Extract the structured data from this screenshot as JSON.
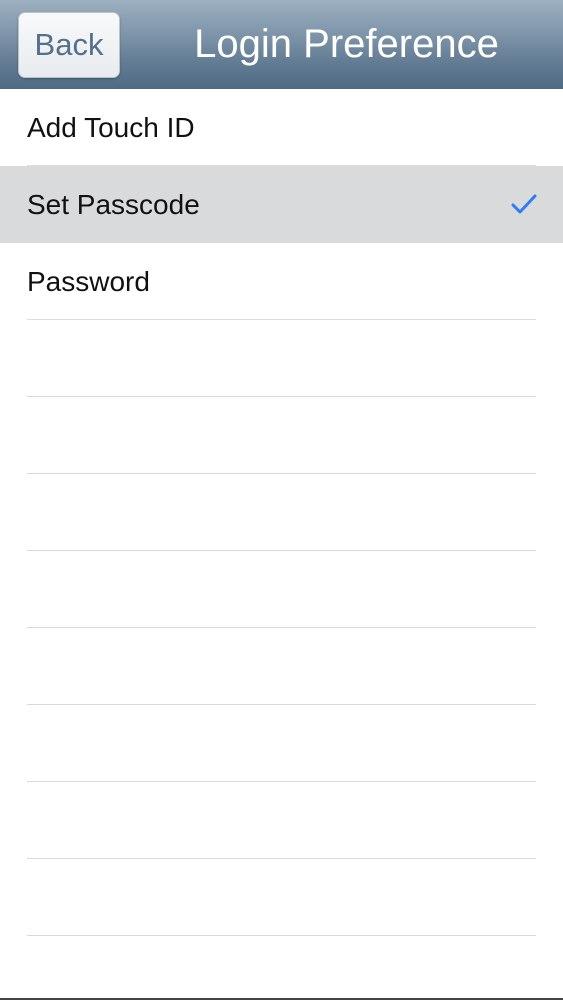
{
  "navbar": {
    "back_label": "Back",
    "title": "Login Preference"
  },
  "list": {
    "items": [
      {
        "label": "Add Touch ID",
        "selected": false
      },
      {
        "label": "Set Passcode",
        "selected": true
      },
      {
        "label": "Password",
        "selected": false
      }
    ],
    "empty_rows": 9,
    "checkmark_icon": "checkmark-icon",
    "checkmark_color": "#2f7cf6",
    "selected_background": "#d9dadc"
  }
}
